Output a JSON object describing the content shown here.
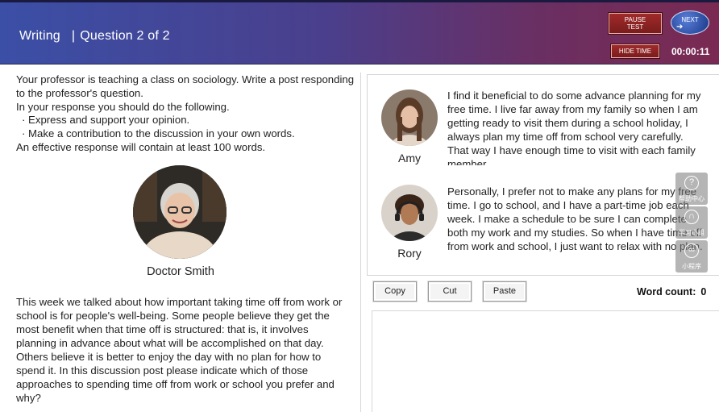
{
  "header": {
    "section": "Writing",
    "divider": "|",
    "question_progress": "Question 2 of 2",
    "pause_label_line1": "PAUSE",
    "pause_label_line2": "TEST",
    "next_label": "NEXT",
    "hide_time_label": "HIDE TIME",
    "timer": "00:00:11"
  },
  "prompt": {
    "intro": "Your professor is teaching a class on sociology. Write a post responding to the professor's question.",
    "instructions_lead": "In your response you should do the following.",
    "bullets": [
      "· Express and support your opinion.",
      "· Make a contribution to the discussion in your own words."
    ],
    "length_note": "An effective response will contain at least 100 words."
  },
  "professor": {
    "name": "Doctor Smith",
    "question": "This week we talked about how important taking time off from work or school is for people's well-being. Some people believe they get the most benefit when that time off is structured: that is, it involves planning in advance about what will be accomplished on that day. Others believe it is better to enjoy the day with no plan for how to spend it. In this discussion post please indicate which of those approaches to spending time off from work or school you prefer and why?"
  },
  "students": [
    {
      "name": "Amy",
      "post": "I find it beneficial to do some advance planning for my free time. I live far away from my family so when I am getting ready to visit them during a school holiday, I always plan my time off from school very carefully. That way I have enough time to visit with each family member."
    },
    {
      "name": "Rory",
      "post": "Personally, I prefer not to make any plans for my free time. I go to school, and I have a part-time job each week. I make a schedule to be sure I can complete both my work and my studies. So when I have time off from work and school, I just want to relax with no plan."
    }
  ],
  "editor_toolbar": {
    "copy": "Copy",
    "cut": "Cut",
    "paste": "Paste",
    "word_count_label": "Word count:",
    "word_count": "0"
  },
  "side_tools": [
    {
      "icon": "help-icon",
      "label": "帮助中心"
    },
    {
      "icon": "headset-icon",
      "label": "学习小组"
    },
    {
      "icon": "link-icon",
      "label": "小程序"
    }
  ],
  "colors": {
    "header_start": "#3b4fa6",
    "header_end": "#7a2a52",
    "button_red": "#8a2222",
    "next_blue": "#2a4ca0"
  }
}
